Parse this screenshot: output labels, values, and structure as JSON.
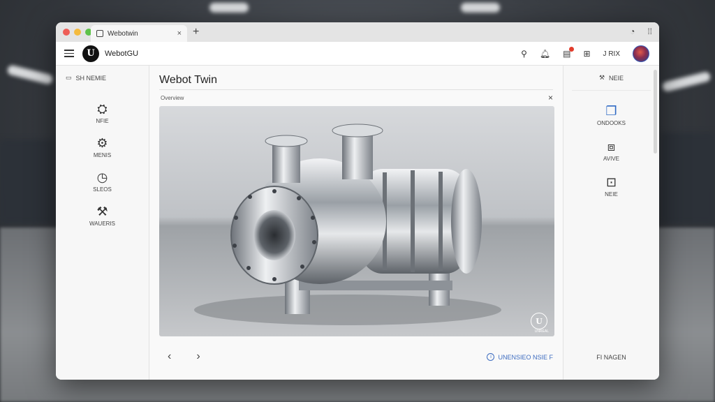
{
  "browser": {
    "tab_title": "Webotwin",
    "tab_close": "×",
    "new_tab": "+"
  },
  "app": {
    "title": "WebotGU",
    "logo_letter": "U",
    "user_label": "J RIX"
  },
  "left_panel": {
    "header": "SH NEMIE",
    "items": [
      {
        "label": "NFIE",
        "icon": "pump-icon"
      },
      {
        "label": "MENIS",
        "icon": "gear-icon"
      },
      {
        "label": "SLEOS",
        "icon": "gauge-icon"
      },
      {
        "label": "WAUERIS",
        "icon": "wrench-icon"
      }
    ]
  },
  "main": {
    "title": "Webot Twin",
    "sub_label": "Overview",
    "close": "×",
    "watermark_letter": "U",
    "watermark_text": "UNREAL",
    "prev": "‹",
    "next": "›",
    "status_link": "UNENSIEO NSIE F"
  },
  "right_panel": {
    "header": "NEIE",
    "items": [
      {
        "label": "ONDOOKS",
        "icon": "document-icon",
        "active": true
      },
      {
        "label": "AVIVE",
        "icon": "cube-icon",
        "active": false
      },
      {
        "label": "NEIE",
        "icon": "box-icon",
        "active": false
      }
    ],
    "footer": "FI NAGEN"
  },
  "colors": {
    "accent": "#2f6ac4",
    "badge": "#e23c2c"
  }
}
